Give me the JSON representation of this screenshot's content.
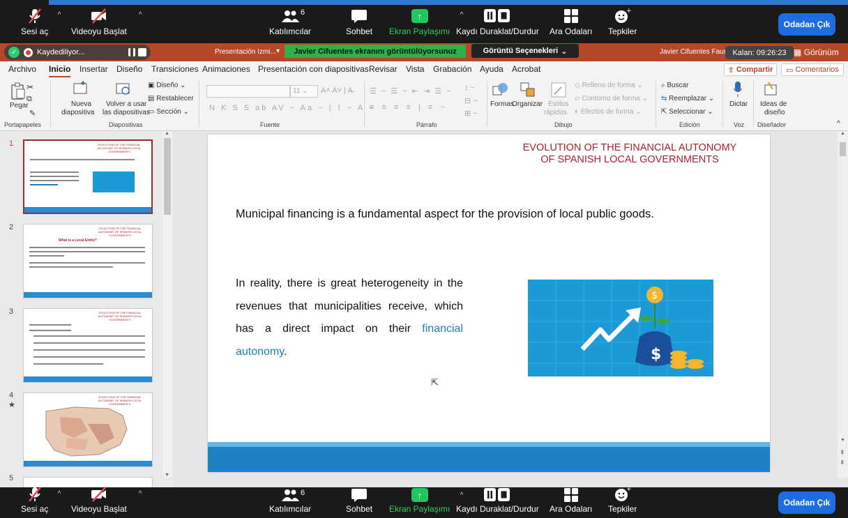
{
  "zoom": {
    "unmute": "Sesi aç",
    "start_video": "Videoyu Başlat",
    "participants": "Katılımcılar",
    "participants_count": "6",
    "chat": "Sohbet",
    "share_screen": "Ekran Paylaşımı",
    "pause_stop_recording": "Kaydı Duraklat/Durdur",
    "breakout_rooms": "Ara Odaları",
    "reactions": "Tepkiler",
    "leave": "Odadan Çık"
  },
  "title_bar": {
    "recording": "Kaydediliyor...",
    "presentation_name": "Presentación Izmi...",
    "share_banner": "Javier Cifuentes ekranını görüntülüyorsunuz",
    "view_options": "Görüntü Seçenekleri",
    "user_name": "Javier Cifuentes Faura",
    "timer": "Kalan: 09:26:23",
    "view": "Görünüm"
  },
  "tabs": [
    "Archivo",
    "Inicio",
    "Insertar",
    "Diseño",
    "Transiciones",
    "Animaciones",
    "Presentación con diapositivas",
    "Revisar",
    "Vista",
    "Grabación",
    "Ayuda",
    "Acrobat"
  ],
  "tab_actions": {
    "share": "Compartir",
    "comments": "Comentarios"
  },
  "ribbon": {
    "paste": "Pegar",
    "new_slide_1": "Nueva",
    "new_slide_2": "diapositiva",
    "reuse_1": "Volver a usar",
    "reuse_2": "las diapositivas",
    "layout": "Diseño",
    "reset": "Restablecer",
    "section": "Sección",
    "font_size": "11",
    "shapes": "Formas",
    "arrange": "Organizar",
    "styles_1": "Estilos",
    "styles_2": "rápidos",
    "fill": "Relleno de forma",
    "outline": "Contorno de forma",
    "effects": "Efectos de forma",
    "find": "Buscar",
    "replace": "Reemplazar",
    "select": "Seleccionar",
    "dictate": "Dictar",
    "designer_1": "Ideas de",
    "designer_2": "diseño",
    "groups": [
      "Portapapeles",
      "Diapositivas",
      "Fuente",
      "Párrafo",
      "Dibujo",
      "Edición",
      "Voz",
      "Diseñador"
    ]
  },
  "thumbnails": [
    {
      "num": "1",
      "title": "EVOLUTION OF THE FINANCIAL AUTONOMY OF SPANISH LOCAL GOVERNMENTS"
    },
    {
      "num": "2",
      "title": "EVOLUTION OF THE FINANCIAL AUTONOMY OF SPANISH LOCAL GOVERNMENTS",
      "heading": "What is a Local Entity?"
    },
    {
      "num": "3",
      "title": "EVOLUTION OF THE FINANCIAL AUTONOMY OF SPANISH LOCAL GOVERNMENTS"
    },
    {
      "num": "4",
      "title": "EVOLUTION OF THE FINANCIAL AUTONOMY OF SPANISH LOCAL GOVERNMENTS"
    }
  ],
  "slide": {
    "title": "EVOLUTION OF THE FINANCIAL AUTONOMY OF SPANISH LOCAL GOVERNMENTS",
    "lead": "Municipal financing is a fundamental aspect for the provision of local public goods.",
    "body_start": "In reality, there is great heterogeneity in the revenues that municipalities receive, which has a direct impact on their ",
    "body_link": "financial autonomy",
    "body_end": "."
  },
  "colors": {
    "ppt_accent": "#b7472a",
    "slide_title": "#b01f2e",
    "slide_footer": "#2080c4",
    "zoom_leave": "#1d6ce0",
    "zoom_share": "#22c55e"
  }
}
